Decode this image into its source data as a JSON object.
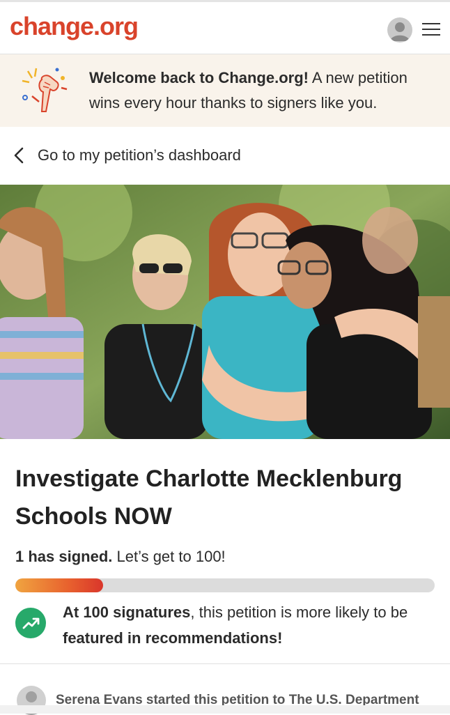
{
  "header": {
    "logo_text": "change.org",
    "brand_color": "#d9432b",
    "avatar_icon": "user-avatar-icon",
    "menu_icon": "hamburger-menu-icon"
  },
  "banner": {
    "bold_text": "Welcome back to Change.org!",
    "text": " A new petition wins every hour thanks to signers like you.",
    "illustration": "raised-fist-celebration-illustration"
  },
  "dashboard_link": {
    "label": "Go to my petition’s dashboard",
    "icon": "chevron-left-icon"
  },
  "hero": {
    "image": "photo-crowd-hugging"
  },
  "petition": {
    "title": "Investigate Charlotte Mecklenburg Schools NOW",
    "signed_bold": "1 has signed.",
    "signed_rest": " Let’s get to 100!",
    "progress_fraction": 0.21,
    "goal_bold1": "At 100 signatures",
    "goal_text1": ", this petition is more likely to be ",
    "goal_bold2": "featured in recommendations!",
    "goal_icon": "trending-up-icon",
    "accent_green": "#27a96a"
  },
  "starter": {
    "text": "Serena Evans started this petition to The U.S. Department"
  }
}
